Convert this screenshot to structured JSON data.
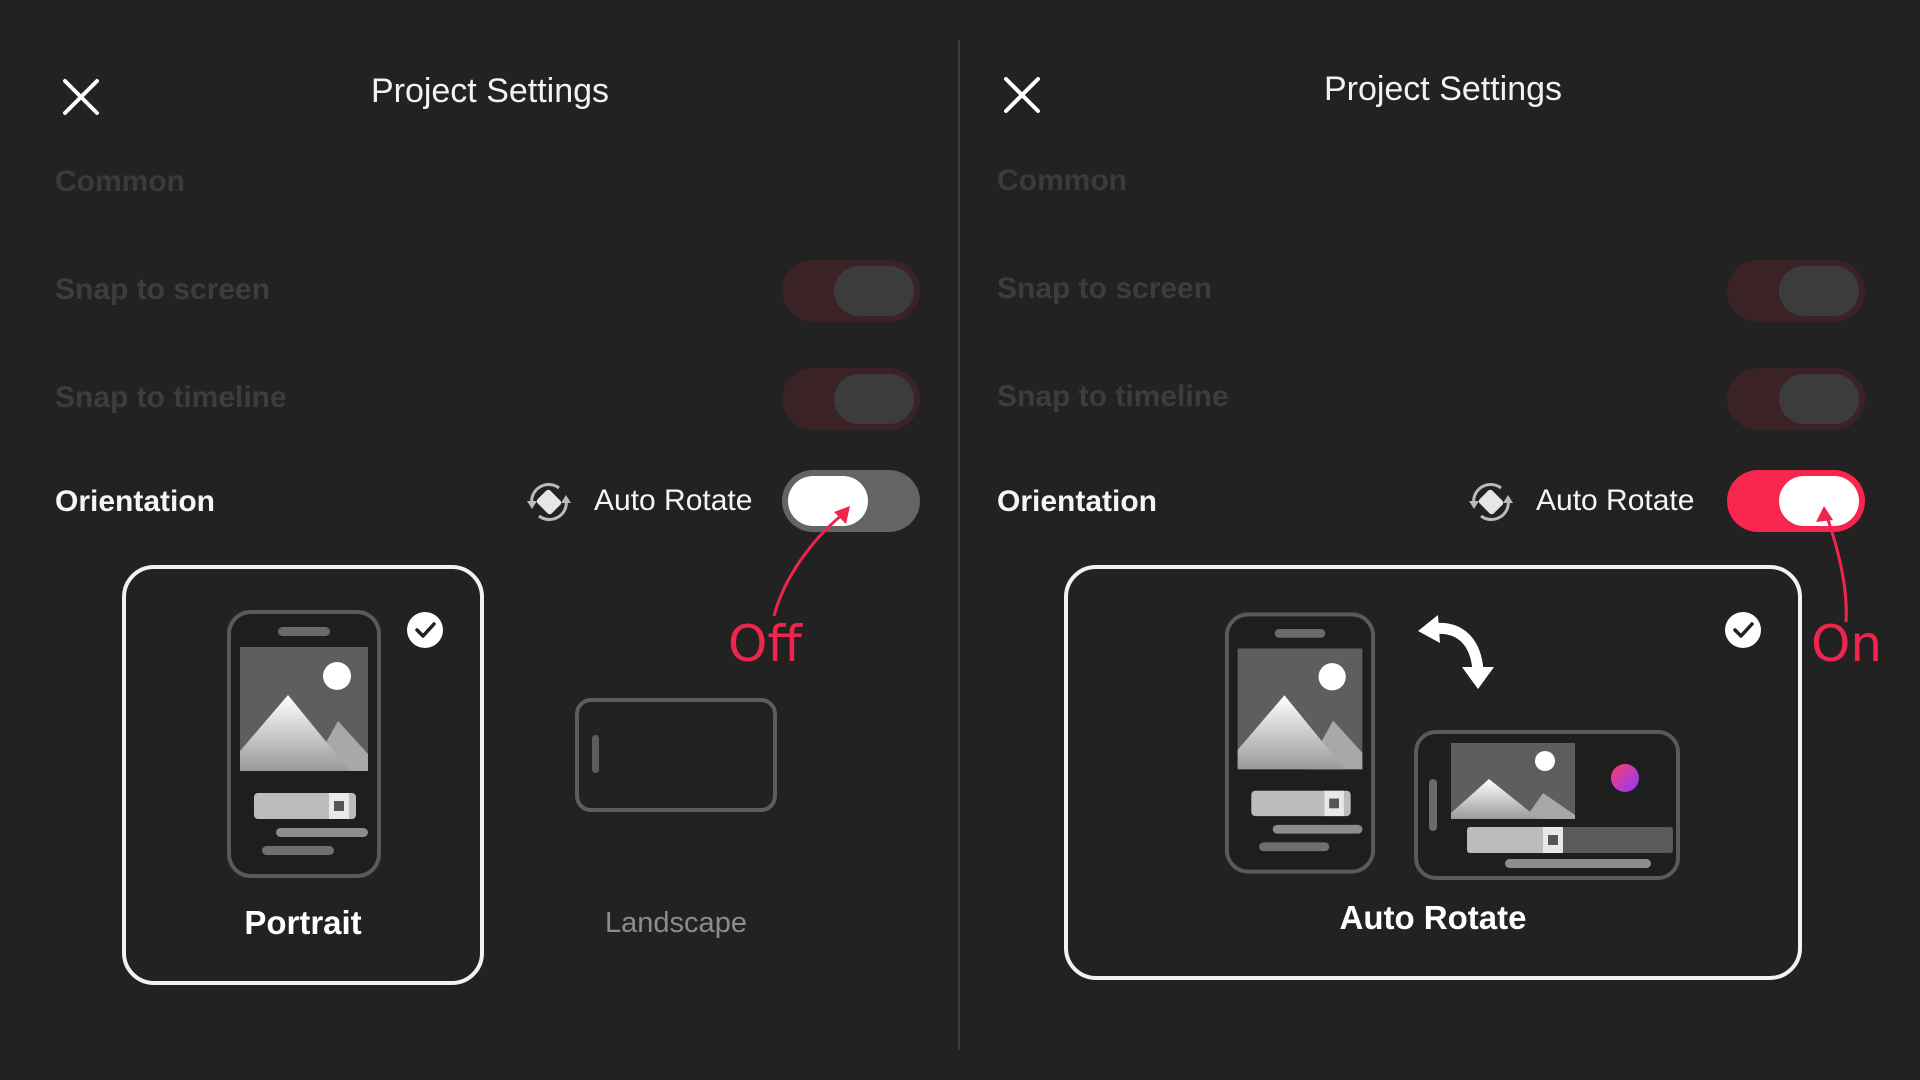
{
  "left_panel": {
    "title": "Project Settings",
    "close_icon": "close-icon",
    "section_label": "Common",
    "snap_to_screen": {
      "label": "Snap to screen",
      "state": "disabled"
    },
    "snap_to_timeline": {
      "label": "Snap to timeline",
      "state": "disabled"
    },
    "orientation": {
      "label": "Orientation",
      "auto_rotate_icon": "auto-rotate-icon",
      "auto_rotate_label": "Auto Rotate",
      "auto_rotate_on": false
    },
    "options": [
      {
        "label": "Portrait",
        "selected": true
      },
      {
        "label": "Landscape",
        "selected": false
      }
    ],
    "annotation": "Off"
  },
  "right_panel": {
    "title": "Project Settings",
    "close_icon": "close-icon",
    "section_label": "Common",
    "snap_to_screen": {
      "label": "Snap to screen",
      "state": "disabled"
    },
    "snap_to_timeline": {
      "label": "Snap to timeline",
      "state": "disabled"
    },
    "orientation": {
      "label": "Orientation",
      "auto_rotate_icon": "auto-rotate-icon",
      "auto_rotate_label": "Auto Rotate",
      "auto_rotate_on": true
    },
    "options": [
      {
        "label": "Auto Rotate",
        "selected": true
      }
    ],
    "annotation": "On"
  },
  "colors": {
    "background": "#222222",
    "accent": "#f8264f",
    "annotation": "#f0254d",
    "disabled_text": "#3d3d3d"
  }
}
